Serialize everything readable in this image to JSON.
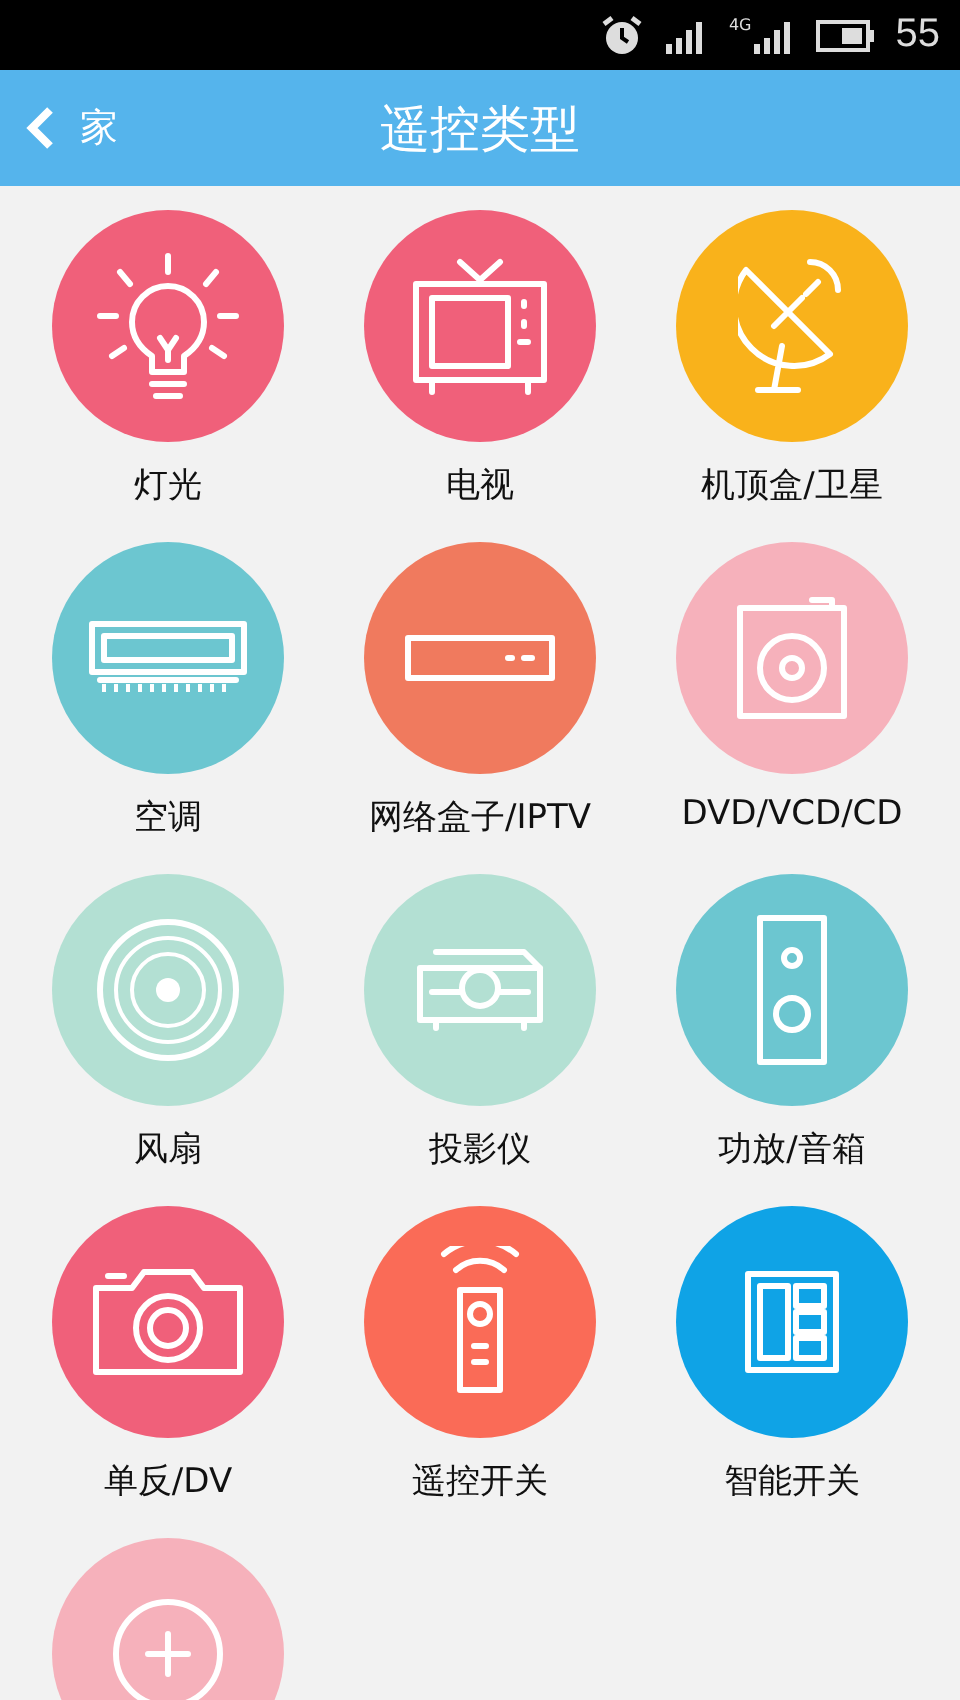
{
  "status_bar": {
    "network": "4G",
    "battery_level_text": "55"
  },
  "header": {
    "back_label": "家",
    "title": "遥控类型"
  },
  "devices": [
    {
      "kind": "bulb",
      "label": "灯光",
      "color": "#f0607a"
    },
    {
      "kind": "tv",
      "label": "电视",
      "color": "#f0607a"
    },
    {
      "kind": "satellite",
      "label": "机顶盒/卫星",
      "color": "#f9b21b"
    },
    {
      "kind": "aircon",
      "label": "空调",
      "color": "#6cc6d0"
    },
    {
      "kind": "box",
      "label": "网络盒子/IPTV",
      "color": "#f07a5e"
    },
    {
      "kind": "dvd",
      "label": "DVD/VCD/CD",
      "color": "#f6b1bb"
    },
    {
      "kind": "fan",
      "label": "风扇",
      "color": "#b3e0d3"
    },
    {
      "kind": "projector",
      "label": "投影仪",
      "color": "#b3e0d3"
    },
    {
      "kind": "speaker",
      "label": "功放/音箱",
      "color": "#6cc6d0"
    },
    {
      "kind": "camera",
      "label": "单反/DV",
      "color": "#f0607a"
    },
    {
      "kind": "remote",
      "label": "遥控开关",
      "color": "#fa6b57"
    },
    {
      "kind": "switch",
      "label": "智能开关",
      "color": "#0fa3e6"
    },
    {
      "kind": "add",
      "color": "#f6b1bb"
    }
  ]
}
